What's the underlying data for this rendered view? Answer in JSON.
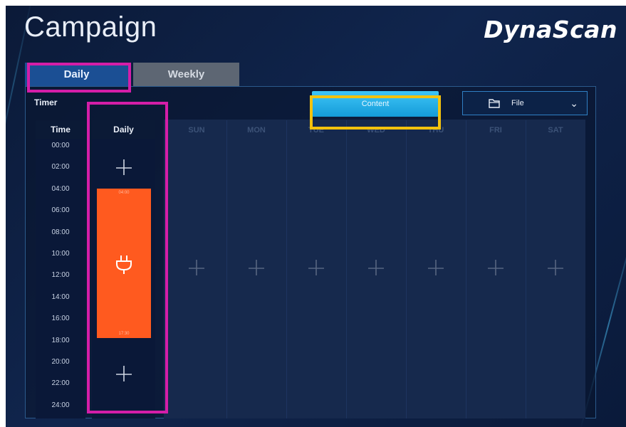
{
  "header": {
    "title": "Campaign",
    "logo": "DynaScan"
  },
  "tabs": [
    {
      "label": "Daily",
      "active": true
    },
    {
      "label": "Weekly",
      "active": false
    }
  ],
  "toolbar": {
    "timer_label": "Timer",
    "content_label": "Content",
    "file_label": "File",
    "file_icon": "folder-icon",
    "dropdown_icon": "chevron-down-icon"
  },
  "schedule": {
    "time_header": "Time",
    "daily_header": "Daily",
    "days": [
      "SUN",
      "MON",
      "TUE",
      "WED",
      "THU",
      "FRI",
      "SAT"
    ],
    "times": [
      "00:00",
      "02:00",
      "04:00",
      "06:00",
      "08:00",
      "10:00",
      "12:00",
      "14:00",
      "16:00",
      "18:00",
      "20:00",
      "22:00",
      "24:00"
    ],
    "block": {
      "start": "04:00",
      "end": "17:30",
      "color": "#ff5a1f",
      "icon": "plug-icon"
    }
  },
  "colors": {
    "accent_blue": "#149bd8",
    "highlight_magenta": "#d41ea8",
    "highlight_yellow": "#f4c20d",
    "background": "#10254d"
  }
}
